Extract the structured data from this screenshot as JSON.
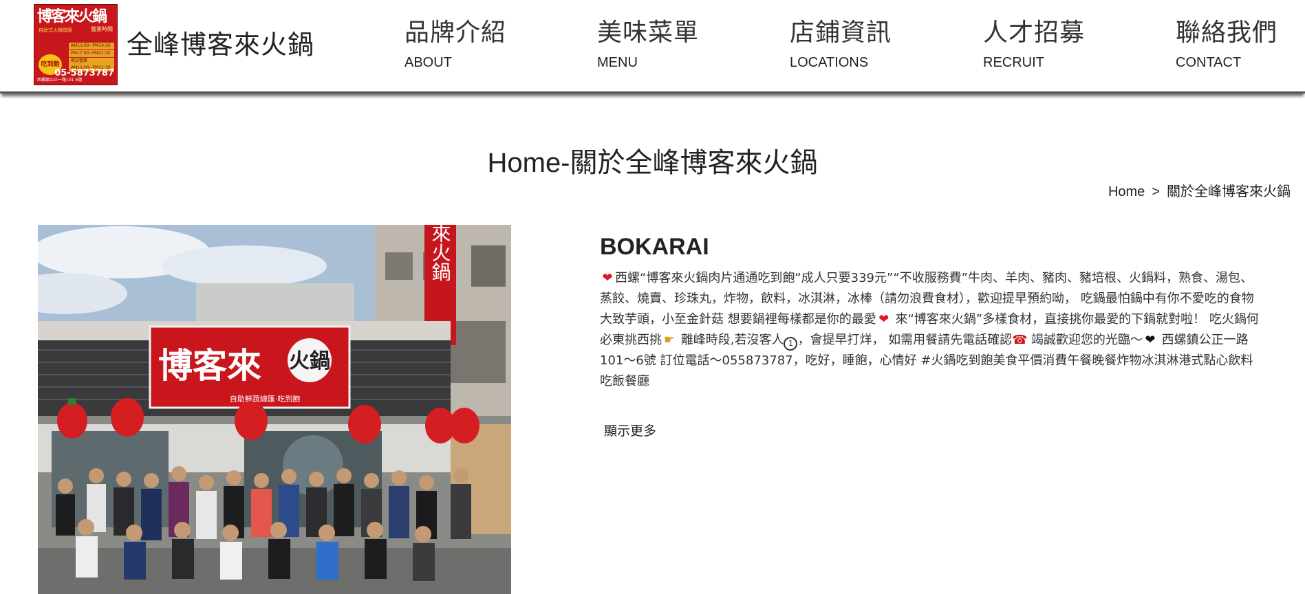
{
  "header": {
    "logo": {
      "brand": "博客來火鍋",
      "sub": "自助式火鍋總匯",
      "tag": "營業時間",
      "times": [
        "AM11:00~PM14:30",
        "PM17:00~PM21:30",
        "假日營業AM11:00~PM21:30"
      ],
      "badge": "吃到飽",
      "phone": "05-5873787",
      "address": "西螺鎮公正一路101-6號"
    },
    "site_name": "全峰博客來火鍋",
    "nav": [
      {
        "zh": "品牌介紹",
        "en": "ABOUT"
      },
      {
        "zh": "美味菜單",
        "en": "MENU"
      },
      {
        "zh": "店鋪資訊",
        "en": "LOCATIONS"
      },
      {
        "zh": "人才招募",
        "en": "RECRUIT"
      },
      {
        "zh": "聯絡我們",
        "en": "CONTACT"
      }
    ]
  },
  "page": {
    "title": "Home-關於全峰博客來火鍋",
    "breadcrumb": {
      "home": "Home",
      "separator": ">",
      "current": "關於全峰博客來火鍋"
    }
  },
  "photo": {
    "sign_left": "博客來",
    "sign_right": "火鍋",
    "sign_sub": "自助鮮蔬總匯·吃到飽",
    "vertical_sign": "來火鍋"
  },
  "content": {
    "heading": "BOKARAI",
    "desc": {
      "s1": "西螺“博客來火鍋肉片通通吃到飽“成人只要339元”“不收服務費”牛肉、羊肉、豬肉、豬培根、火鍋料，熟食、湯包、蒸餃、燒賣、珍珠丸，炸物，飲料，冰淇淋，冰棒（請勿浪費食材），歡迎提早預約呦， 吃鍋最怕鍋中有你不愛吃的食物 大致芋頭，小至金針菇 想要鍋裡每樣都是你的最愛",
      "s2": " 來“博客來火鍋”多樣食材，直接挑你最愛的下鍋就對啦！ 吃火鍋何必東挑西挑",
      "s3": " 離峰時段,若沒客人",
      "s4": "，會提早打烊， 如需用餐請先電話確認",
      "s5": " 竭誠歡迎您的光臨～",
      "s6": " 西螺鎮公正一路101～6號 訂位電話～055873787，吃好，睡飽，心情好 #火鍋吃到飽美食平價消費午餐晚餐炸物冰淇淋港式點心飲料吃飯餐廳"
    },
    "show_more": "顯示更多"
  },
  "colors": {
    "logo_red": "#c8161d",
    "heart": "#e0162b",
    "text": "#222222"
  }
}
